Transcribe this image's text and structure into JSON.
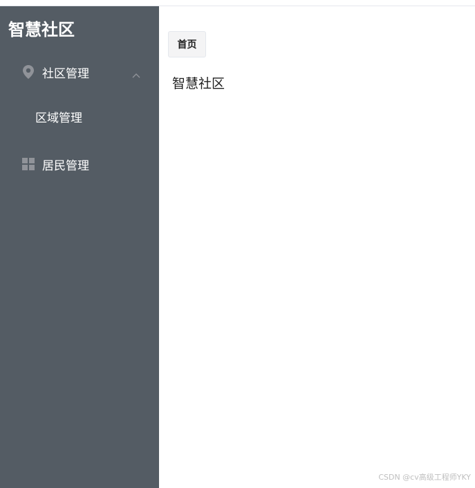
{
  "sidebar": {
    "brand": "智慧社区",
    "menu": [
      {
        "label": "社区管理",
        "icon": "location-pin-icon",
        "expanded": true
      },
      {
        "label": "区域管理",
        "submenu": true
      },
      {
        "label": "居民管理",
        "icon": "grid-icon"
      }
    ]
  },
  "main": {
    "tab_label": "首页",
    "content_text": "智慧社区"
  },
  "watermark": "CSDN @cv高级工程师YKY",
  "colors": {
    "sidebar_bg": "#545c64",
    "icon_gray": "#909399",
    "tab_bg": "#f4f4f5"
  }
}
